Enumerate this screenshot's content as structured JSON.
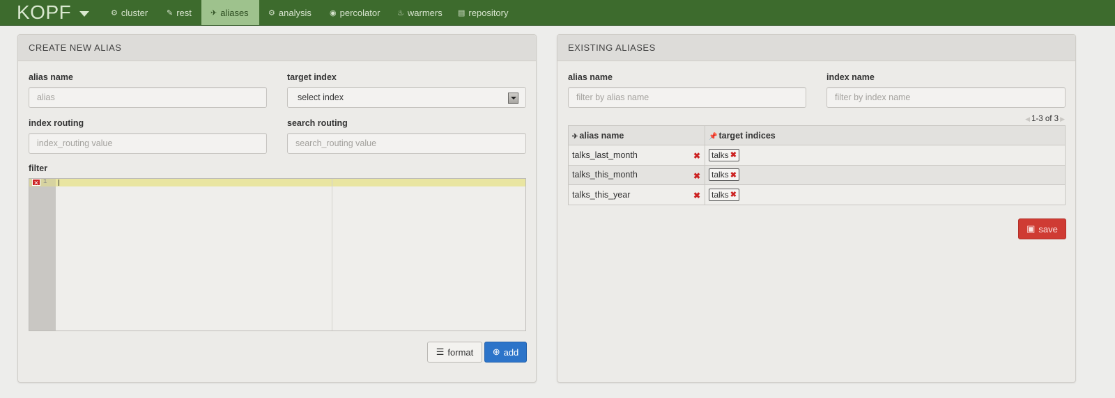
{
  "nav": {
    "brand": "KOPF",
    "items": [
      {
        "icon": "⚙",
        "label": "cluster"
      },
      {
        "icon": "✎",
        "label": "rest"
      },
      {
        "icon": "✈",
        "label": "aliases"
      },
      {
        "icon": "⚙",
        "label": "analysis"
      },
      {
        "icon": "◉",
        "label": "percolator"
      },
      {
        "icon": "♨",
        "label": "warmers"
      },
      {
        "icon": "▤",
        "label": "repository"
      }
    ],
    "active": "aliases"
  },
  "create": {
    "title": "CREATE NEW ALIAS",
    "alias_name_label": "alias name",
    "alias_name_placeholder": "alias",
    "target_index_label": "target index",
    "target_index_value": "select index",
    "index_routing_label": "index routing",
    "index_routing_placeholder": "index_routing value",
    "search_routing_label": "search routing",
    "search_routing_placeholder": "search_routing value",
    "filter_label": "filter",
    "editor_line_number": "1",
    "format_label": "format",
    "add_label": "add"
  },
  "existing": {
    "title": "EXISTING ALIASES",
    "alias_name_label": "alias name",
    "alias_filter_placeholder": "filter by alias name",
    "index_name_label": "index name",
    "index_filter_placeholder": "filter by index name",
    "pager_text": "1-3 of 3",
    "col_alias": "alias name",
    "col_targets": "target indices",
    "rows": [
      {
        "alias": "talks_last_month",
        "index": "talks"
      },
      {
        "alias": "talks_this_month",
        "index": "talks"
      },
      {
        "alias": "talks_this_year",
        "index": "talks"
      }
    ],
    "save_label": "save"
  },
  "colors": {
    "navbar": "#3d6b2d",
    "nav_active": "#9ec28d",
    "add_button": "#2c74c9",
    "save_button": "#cf3b33",
    "remove_icon": "#cc2222"
  }
}
